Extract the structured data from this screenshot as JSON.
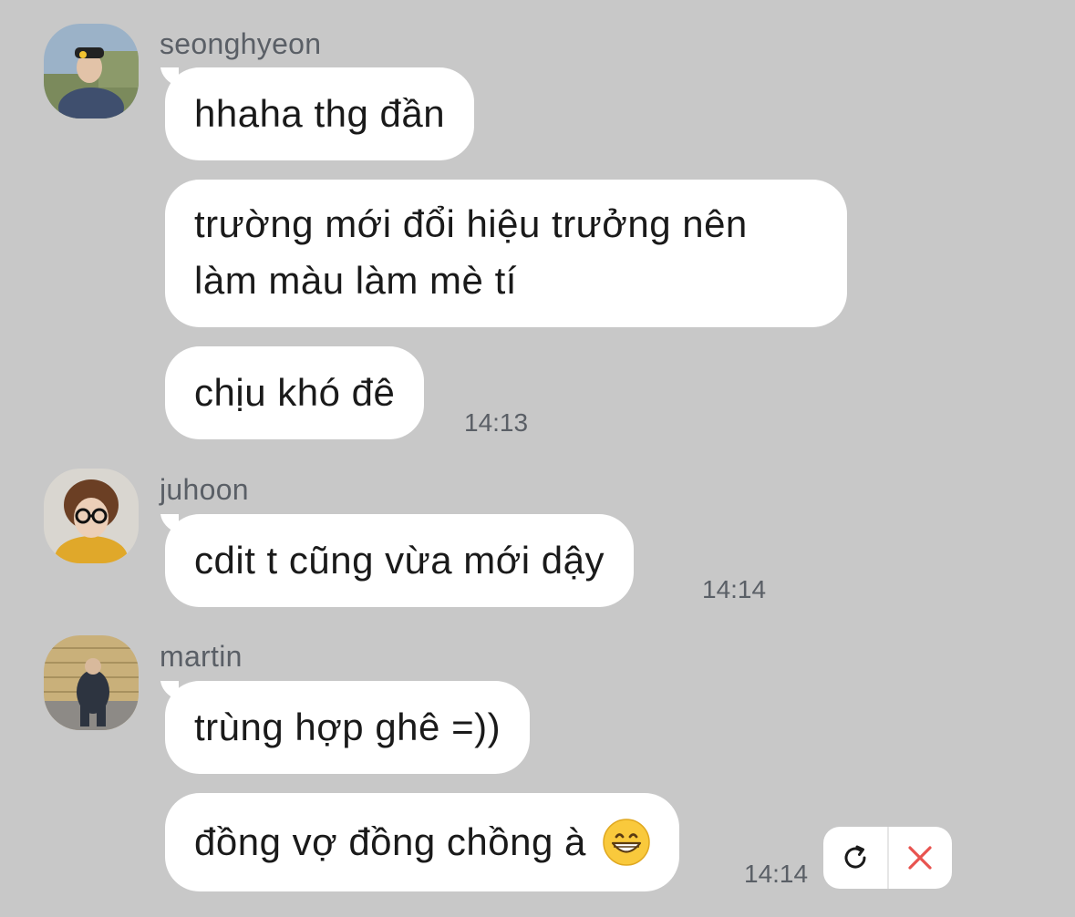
{
  "messages": [
    {
      "sender": "seonghyeon",
      "avatar_icon": "avatar-seonghyeon",
      "bubbles": [
        "hhaha thg đần",
        "trường mới đổi hiệu trưởng nên làm màu làm mè tí",
        "chịu khó đê"
      ],
      "time": "14:13"
    },
    {
      "sender": "juhoon",
      "avatar_icon": "avatar-juhoon",
      "bubbles": [
        "cdit t cũng vừa mới dậy"
      ],
      "time": "14:14"
    },
    {
      "sender": "martin",
      "avatar_icon": "avatar-martin",
      "bubbles": [
        "trùng hợp ghê =))",
        "đồng vợ đồng chồng à"
      ],
      "emoji": "grinning-face-icon",
      "time": "14:14"
    }
  ],
  "failed_actions": {
    "retry_icon": "retry-icon",
    "delete_icon": "close-icon",
    "delete_color": "#e8534f"
  },
  "colors": {
    "background": "#c8c8c8",
    "bubble": "#ffffff",
    "meta_text": "#5a5f66"
  }
}
